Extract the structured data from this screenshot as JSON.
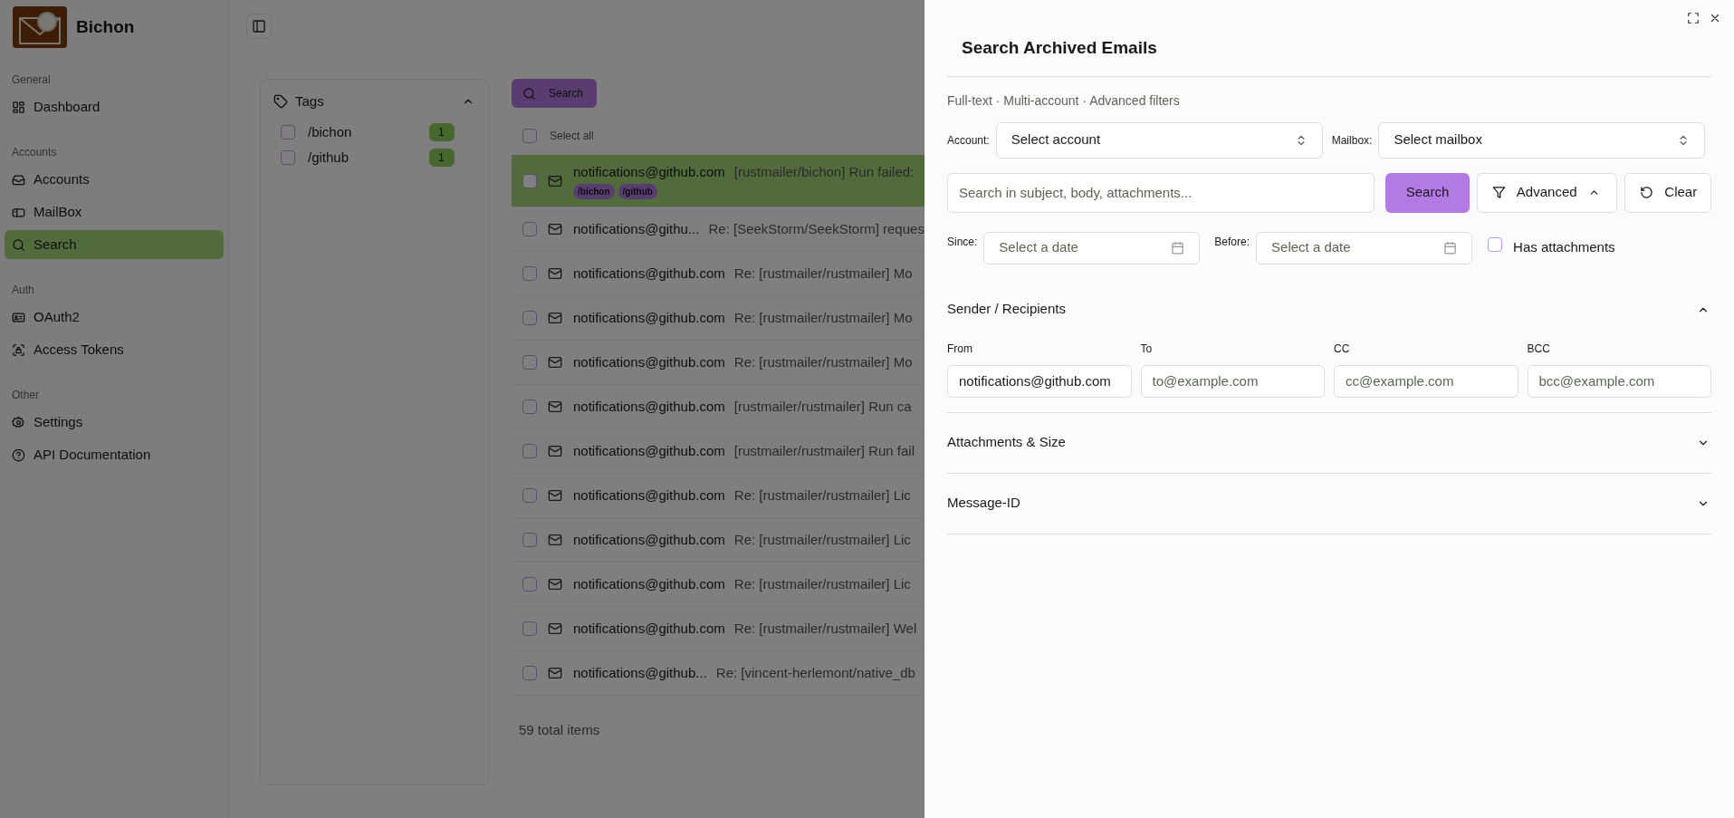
{
  "sidebar": {
    "brand": "Bichon",
    "groups": [
      {
        "label": "General",
        "items": [
          {
            "label": "Dashboard",
            "selected": false
          }
        ]
      },
      {
        "label": "Accounts",
        "items": [
          {
            "label": "Accounts",
            "selected": false
          },
          {
            "label": "MailBox",
            "selected": false
          },
          {
            "label": "Search",
            "selected": true
          }
        ]
      },
      {
        "label": "Auth",
        "items": [
          {
            "label": "OAuth2",
            "selected": false
          },
          {
            "label": "Access Tokens",
            "selected": false
          }
        ]
      },
      {
        "label": "Other",
        "items": [
          {
            "label": "Settings",
            "selected": false
          },
          {
            "label": "API Documentation",
            "selected": false
          }
        ]
      }
    ]
  },
  "tags_panel": {
    "title": "Tags",
    "expanded": true,
    "tags": [
      {
        "label": "/bichon",
        "count": "1",
        "checked": false
      },
      {
        "label": "/github",
        "count": "1",
        "checked": false
      }
    ]
  },
  "toolbar": {
    "search_button": "Search"
  },
  "email_list": {
    "select_all": {
      "label": "Select all",
      "checked": false
    },
    "rows": [
      {
        "sender": "notifications@github.com",
        "subject": "[rustmailer/bichon] Run failed:",
        "selected": true,
        "checked": false,
        "tags": [
          "/bichon",
          "/github"
        ]
      },
      {
        "sender": "notifications@githu...",
        "subject": "Re: [SeekStorm/SeekStorm] reques",
        "selected": false,
        "checked": false
      },
      {
        "sender": "notifications@github.com",
        "subject": "Re: [rustmailer/rustmailer] Mo",
        "selected": false,
        "checked": false
      },
      {
        "sender": "notifications@github.com",
        "subject": "Re: [rustmailer/rustmailer] Mo",
        "selected": false,
        "checked": false
      },
      {
        "sender": "notifications@github.com",
        "subject": "Re: [rustmailer/rustmailer] Mo",
        "selected": false,
        "checked": false
      },
      {
        "sender": "notifications@github.com",
        "subject": "[rustmailer/rustmailer] Run ca",
        "selected": false,
        "checked": false
      },
      {
        "sender": "notifications@github.com",
        "subject": "[rustmailer/rustmailer] Run fail",
        "selected": false,
        "checked": false
      },
      {
        "sender": "notifications@github.com",
        "subject": "Re: [rustmailer/rustmailer] Lic",
        "selected": false,
        "checked": false
      },
      {
        "sender": "notifications@github.com",
        "subject": "Re: [rustmailer/rustmailer] Lic",
        "selected": false,
        "checked": false
      },
      {
        "sender": "notifications@github.com",
        "subject": "Re: [rustmailer/rustmailer] Lic",
        "selected": false,
        "checked": false
      },
      {
        "sender": "notifications@github.com",
        "subject": "Re: [rustmailer/rustmailer] Wel",
        "selected": false,
        "checked": false
      },
      {
        "sender": "notifications@github...",
        "subject": "Re: [vincent-herlemont/native_db",
        "selected": false,
        "checked": false
      }
    ],
    "total": "59 total items"
  },
  "drawer": {
    "title": "Search Archived Emails",
    "subtitle": "Full-text · Multi-account · Advanced filters",
    "account": {
      "label": "Account:",
      "placeholder": "Select account"
    },
    "mailbox": {
      "label": "Mailbox:",
      "placeholder": "Select mailbox"
    },
    "search": {
      "placeholder": "Search in subject, body, attachments..."
    },
    "search_button": "Search",
    "advanced_button": {
      "label": "Advanced",
      "expanded": true
    },
    "clear_button": "Clear",
    "since": {
      "label": "Since:",
      "placeholder": "Select a date"
    },
    "before": {
      "label": "Before:",
      "placeholder": "Select a date"
    },
    "has_attachments": {
      "label": "Has attachments",
      "checked": false
    },
    "sections": [
      {
        "title": "Sender / Recipients",
        "expanded": true,
        "fields": [
          {
            "label": "From",
            "value": "notifications@github.com"
          },
          {
            "label": "To",
            "placeholder": "to@example.com"
          },
          {
            "label": "CC",
            "placeholder": "cc@example.com"
          },
          {
            "label": "BCC",
            "placeholder": "bcc@example.com"
          }
        ]
      },
      {
        "title": "Attachments & Size",
        "expanded": false
      },
      {
        "title": "Message-ID",
        "expanded": false
      }
    ]
  }
}
